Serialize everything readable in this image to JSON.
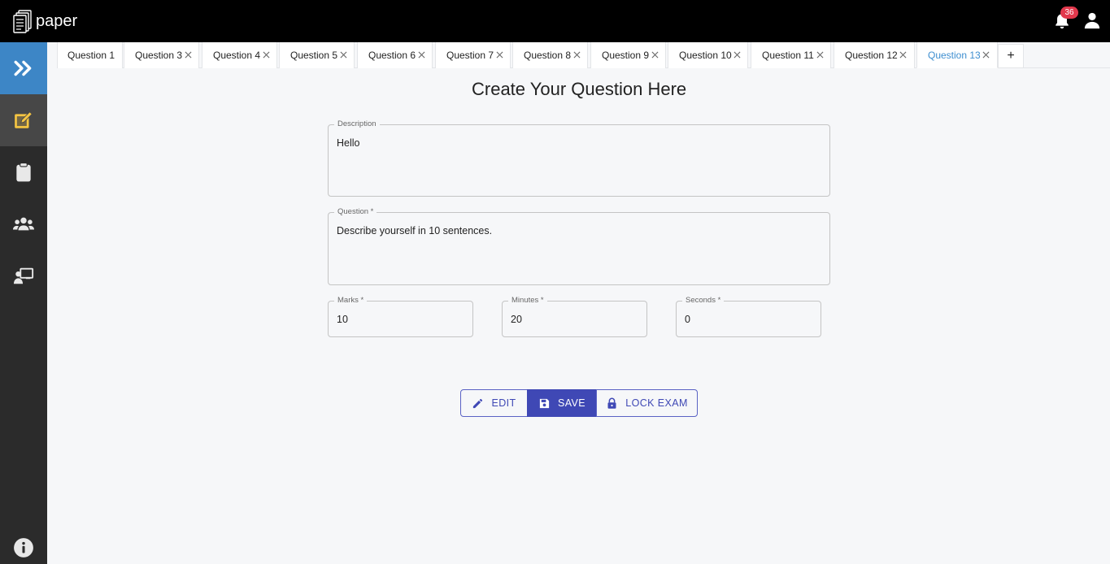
{
  "app": {
    "name": "paper"
  },
  "header": {
    "notification_count": "36"
  },
  "sidebar": {
    "items": [
      {
        "icon": "double-chevron-right-icon"
      },
      {
        "icon": "edit-note-icon",
        "active": true,
        "accent": "#f5c542"
      },
      {
        "icon": "clipboard-icon"
      },
      {
        "icon": "users-group-icon"
      },
      {
        "icon": "teacher-board-icon"
      },
      {
        "icon": "info-icon"
      }
    ]
  },
  "tabs": [
    {
      "label": "Question 1",
      "closable": false
    },
    {
      "label": "Question 3",
      "closable": true
    },
    {
      "label": "Question 4",
      "closable": true
    },
    {
      "label": "Question 5",
      "closable": true
    },
    {
      "label": "Question 6",
      "closable": true
    },
    {
      "label": "Question 7",
      "closable": true
    },
    {
      "label": "Question 8",
      "closable": true
    },
    {
      "label": "Question 9",
      "closable": true
    },
    {
      "label": "Question 10",
      "closable": true
    },
    {
      "label": "Question 11",
      "closable": true
    },
    {
      "label": "Question 12",
      "closable": true
    },
    {
      "label": "Question 13",
      "closable": true,
      "active": true
    }
  ],
  "tab_add_label": "+",
  "form": {
    "title": "Create Your Question Here",
    "description": {
      "label": "Description",
      "value": "Hello"
    },
    "question": {
      "label": "Question *",
      "value": "Describe yourself in 10 sentences."
    },
    "marks": {
      "label": "Marks *",
      "value": "10"
    },
    "minutes": {
      "label": "Minutes *",
      "value": "20"
    },
    "seconds": {
      "label": "Seconds *",
      "value": "0"
    }
  },
  "actions": {
    "edit_label": "EDIT",
    "save_label": "SAVE",
    "lock_label": "LOCK EXAM"
  },
  "colors": {
    "primary": "#3f48b5",
    "sidebar_toggle": "#3d86c6",
    "active_tab": "#3d8ed0",
    "badge": "#e2384c"
  }
}
